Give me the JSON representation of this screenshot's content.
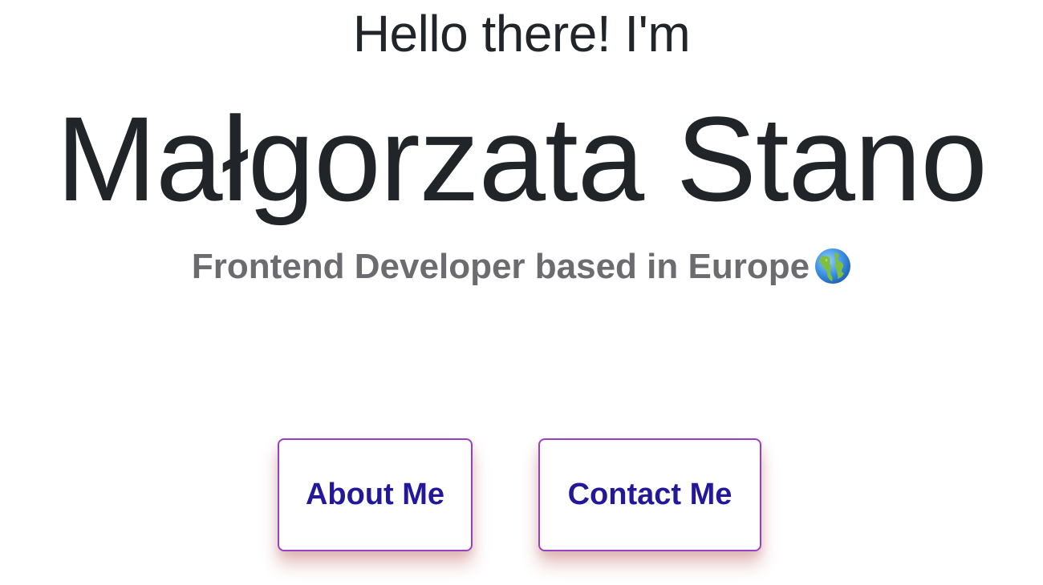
{
  "hero": {
    "greeting": "Hello there! I'm",
    "name": "Małgorzata Stano",
    "subtitle": "Frontend Developer based in Europe",
    "subtitle_icon": "globe-icon"
  },
  "buttons": {
    "about_label": "About Me",
    "contact_label": "Contact Me"
  },
  "colors": {
    "heading": "#212529",
    "subtitle": "#6c6c70",
    "button_text": "#23189a",
    "button_border": "#9a3fc2",
    "button_shadow": "#aa2828"
  }
}
